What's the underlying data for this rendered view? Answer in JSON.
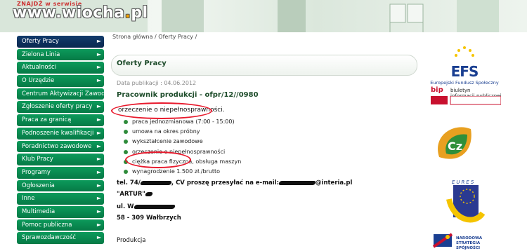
{
  "watermark": {
    "small": "ZNAJDŹ w serwisie",
    "prefix": "www.wiocha",
    "accent": ".",
    "suffix": "pl"
  },
  "breadcrumb": "Strona główna / Oferty Pracy /",
  "panel_title": "Oferty Pracy",
  "publication": "Data publikacji : 04.06.2012",
  "job_title": "Pracownik produkcji - ofpr/12//0980",
  "orzeczenie": "orzeczenie o niepełnosprawności.",
  "sidebar": {
    "items": [
      {
        "label": "Oferty Pracy",
        "active": true
      },
      {
        "label": "Zielona Linia"
      },
      {
        "label": "Aktualności"
      },
      {
        "label": "O Urzędzie"
      },
      {
        "label": "Centrum Aktywizacji Zawodowej"
      },
      {
        "label": "Zgłoszenie oferty pracy"
      },
      {
        "label": "Praca za granicą"
      },
      {
        "label": "Podnoszenie kwalifikacji"
      },
      {
        "label": "Poradnictwo zawodowe"
      },
      {
        "label": "Klub Pracy"
      },
      {
        "label": "Programy"
      },
      {
        "label": "Ogłoszenia"
      },
      {
        "label": "Inne"
      },
      {
        "label": "Multimedia"
      },
      {
        "label": "Pomoc publiczna"
      },
      {
        "label": "Sprawozdawczość"
      }
    ]
  },
  "bullets": [
    "praca jednozmianowa (7:00 - 15:00)",
    "umowa na okres próbny",
    "wykształcenie zawodowe",
    "orzeczenie o niepełnosprawności",
    "ciężka praca fizyczna, obsługa maszyn",
    "wynagrodzenie 1.500 zł./brutto"
  ],
  "contact": {
    "tel_prefix": "tel. 74/",
    "tel_suffix": ", CV proszę przesyłać na e-mail:",
    "email_domain": "@interia.pl",
    "company": "\"ARTUR\"",
    "street_prefix": "ul. W",
    "postal": "58 - 309 Wałbrzych"
  },
  "produkcja": "Produkcja",
  "right_column": {
    "efs_logo": "EFS",
    "efs_label": "Europejski Fundusz Społeczny",
    "bip_logo": "bip",
    "bip_line1": "biuletyn",
    "bip_line2": "informacji publicznej",
    "eures": "EURES",
    "narodowa_line1": "NARODOWA",
    "narodowa_line2": "STRATEGIA SPÓJNOŚCI"
  },
  "colors": {
    "nav_green": "#0c9a5b",
    "nav_active": "#123b6b",
    "annotation_red": "#e8192c",
    "title_green": "#1e4d2b"
  }
}
